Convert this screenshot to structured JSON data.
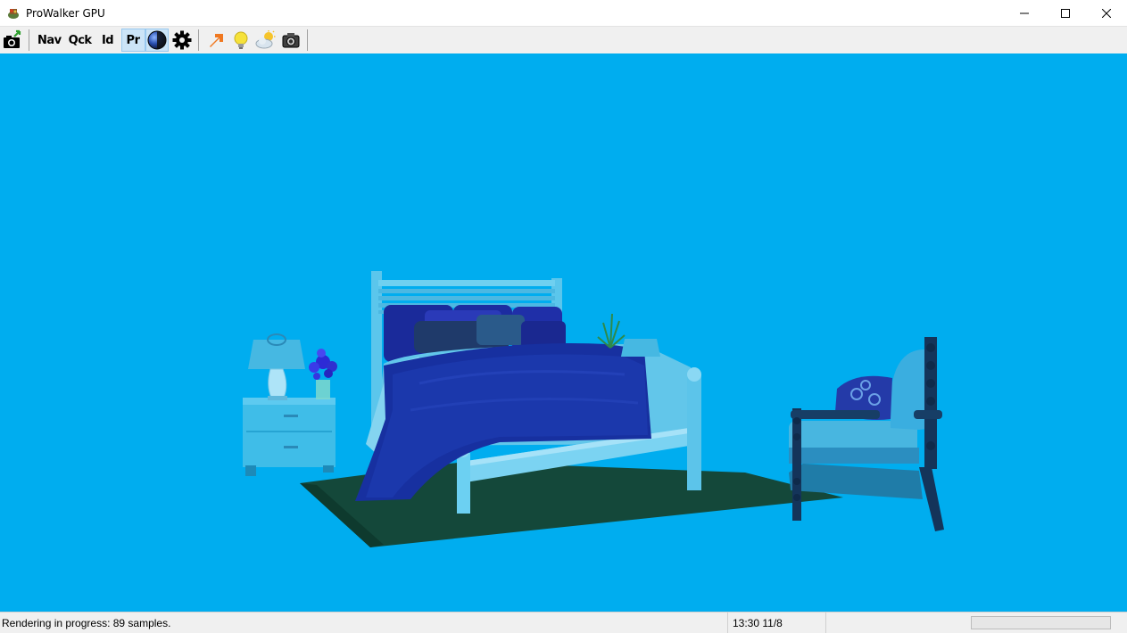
{
  "window": {
    "title": "ProWalker GPU",
    "controls": [
      "minimize-icon",
      "maximize-icon",
      "close-icon"
    ]
  },
  "toolbar": {
    "items": [
      {
        "type": "icon",
        "name": "camera-export-icon"
      },
      {
        "type": "text",
        "label": "Nav"
      },
      {
        "type": "text",
        "label": "Qck"
      },
      {
        "type": "text",
        "label": "Id"
      },
      {
        "type": "text",
        "label": "Pr",
        "pressed": true
      },
      {
        "type": "icon",
        "name": "globe-icon",
        "pressed": true
      },
      {
        "type": "icon",
        "name": "gear-icon"
      },
      {
        "type": "icon",
        "name": "arrow-icon"
      },
      {
        "type": "icon",
        "name": "lightbulb-icon"
      },
      {
        "type": "icon",
        "name": "sun-cloud-icon"
      },
      {
        "type": "icon",
        "name": "camera-icon"
      }
    ],
    "nav_label": "Nav",
    "qck_label": "Qck",
    "id_label": "Id",
    "pr_label": "Pr"
  },
  "viewport": {
    "background_color": "#00adef",
    "scene": "bedroom render"
  },
  "status": {
    "message": "Rendering in progress: 89 samples.",
    "time": "13:30 11/8",
    "progress_fraction": 0
  }
}
